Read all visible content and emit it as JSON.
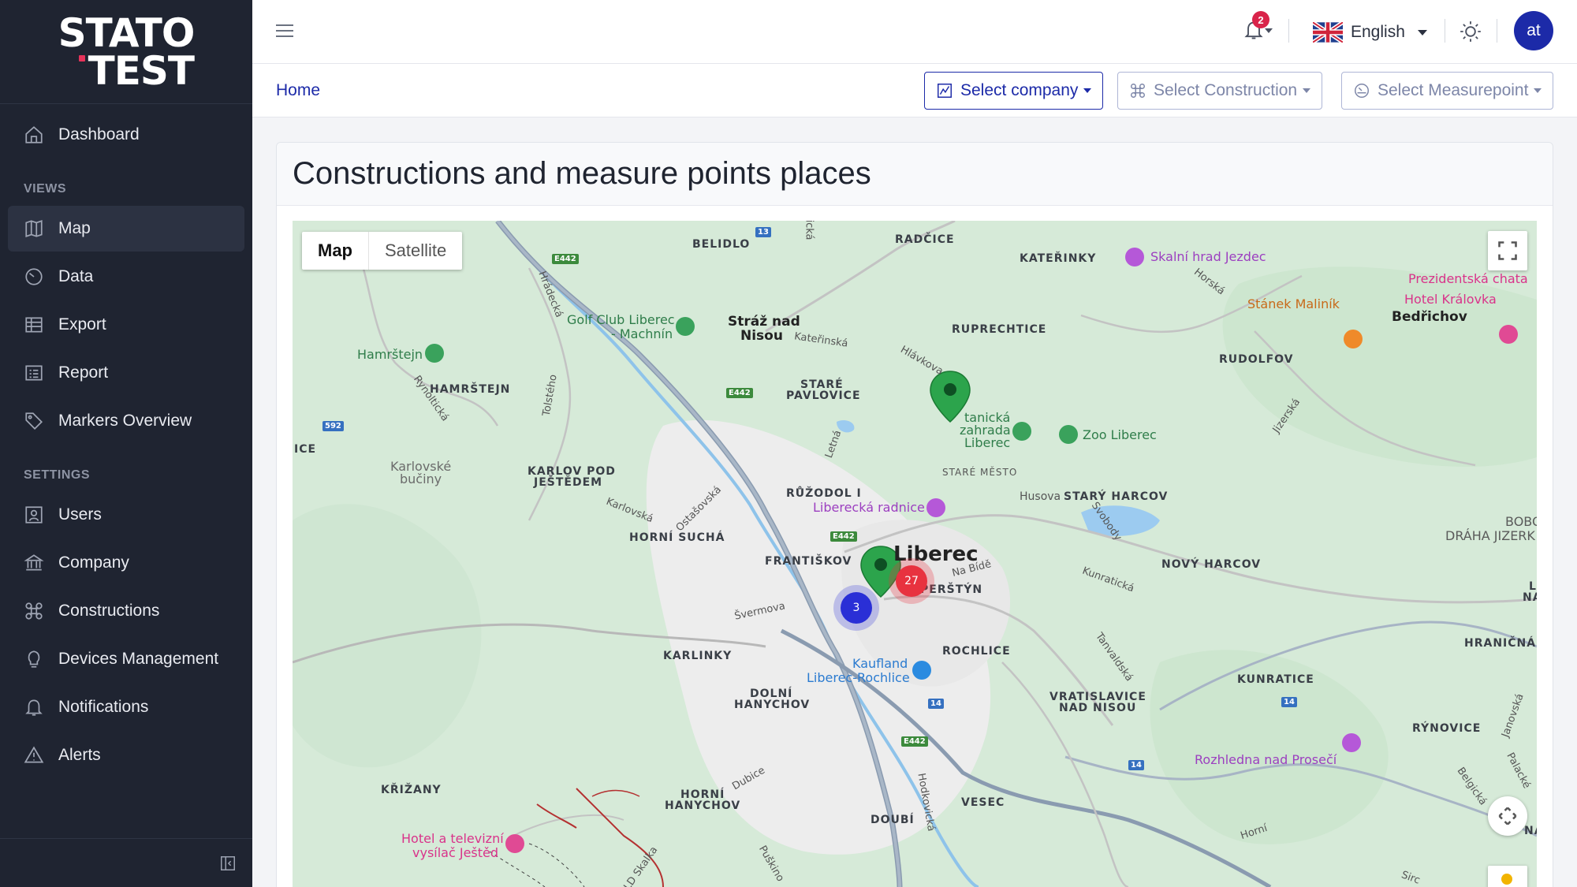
{
  "brand": {
    "line1": "STATO",
    "line2": "TEST"
  },
  "sidebar": {
    "dashboard": "Dashboard",
    "views_heading": "VIEWS",
    "views": [
      "Map",
      "Data",
      "Export",
      "Report",
      "Markers Overview"
    ],
    "settings_heading": "SETTINGS",
    "settings": [
      "Users",
      "Company",
      "Constructions",
      "Devices Management",
      "Notifications",
      "Alerts"
    ],
    "active": "Map"
  },
  "topbar": {
    "notification_count": "2",
    "language": "English",
    "avatar_initials": "at"
  },
  "breadcrumb": {
    "home": "Home"
  },
  "selectors": {
    "company": "Select company",
    "construction": "Select Construction",
    "measurepoint": "Select Measurepoint"
  },
  "card": {
    "title": "Constructions and measure points places"
  },
  "map": {
    "type_map": "Map",
    "type_satellite": "Satellite",
    "clusters": {
      "blue": "3",
      "red": "27"
    },
    "city": "Liberec",
    "labels": {
      "belidlo": "BELIDLO",
      "radcice": "RADČICE",
      "katerinky": "KATEŘINKY",
      "skalni": "Skalní hrad Jezdec",
      "prezidentska": "Prezidentská chata",
      "stanek": "Stánek Maliník",
      "hotel_kralovka": "Hotel Královka",
      "bedrichov": "Bedřichov",
      "golf1": "Golf Club Liberec",
      "golf2": "- Machnín",
      "straz1": "Stráž nad",
      "straz2": "Nisou",
      "ruprechtice": "RUPRECHTICE",
      "rudolfov": "RUDOLFOV",
      "hamrstejn_poi": "Hamrštejn",
      "hamrstejn": "HAMRŠTEJN",
      "stare_pavlovice1": "STARÉ",
      "stare_pavlovice2": "PAVLOVICE",
      "botanicka1": "tanická",
      "botanicka2": "zahrada",
      "botanicka3": "Liberec",
      "zoo": "Zoo Liberec",
      "ice": "ICE",
      "karlovske1": "Karlovské",
      "karlovske2": "bučiny",
      "karlov1": "KARLOV POD",
      "karlov2": "JEŠTĚDEM",
      "stare_mesto": "STARÉ MĚSTO",
      "husova": "Husova",
      "stary_harcov": "STARÝ HARCOV",
      "bobov1": "BOBOV",
      "bobov2": "DRÁHA JIZERK",
      "ruzodol": "RŮŽODOL I",
      "radnice": "Liberecká radnice",
      "horni_sucha": "HORNÍ SUCHÁ",
      "frantiskov": "FRANTIŠKOV",
      "perstyn": "PERŠTÝN",
      "novy_harcov": "NOVÝ HARCOV",
      "kunraticka": "Kunratická",
      "svermova": "Švermova",
      "rochlice": "ROCHLICE",
      "hranicna": "HRANIČNÁ",
      "karlinky": "KARLINKY",
      "kaufland1": "Kaufland",
      "kaufland2": "Liberec-Rochlice",
      "dolni1": "DOLNÍ",
      "dolni2": "HANYCHOV",
      "vratislavice1": "VRATISLAVICE",
      "vratislavice2": "NAD NISOU",
      "kunratice": "KUNRATICE",
      "rynovice": "RÝNOVICE",
      "rozhledna": "Rozhledna nad Prosečí",
      "krizany": "KŘIŽANY",
      "horni_hanychov1": "HORNÍ",
      "horni_hanychov2": "HANYCHOV",
      "vesec": "VESEC",
      "doubi": "DOUBÍ",
      "hotel_tv1": "Hotel a televizní",
      "hotel_tv2": "vysílač Ještěd",
      "horni": "Horní",
      "na_bide": "Na Bídě",
      "katerinska": "Kateřinská",
      "hlavkova": "Hlávkova",
      "letna": "Letná",
      "karlovska": "Karlovská",
      "ostasovska": "Ostašovská",
      "hradecka": "Hrádecká",
      "tolstho": "Tolstého",
      "rynolticka": "Rynoltická",
      "svobody": "Svobody",
      "tanvaldska": "Tanvaldská",
      "jizerska": "Jizerská",
      "horska": "Horská",
      "dubice": "Dubice",
      "hodkovicka": "Hodkovická",
      "janovska": "Janovská",
      "palackeho": "Palacké",
      "belgicka": "Belgická",
      "puskinova": "Puškino",
      "skalka": "LD Skalka",
      "ka": "ická",
      "l_right": "L",
      "na_right": "NA",
      "na_right2": "NA",
      "sircova": "Sirc",
      "road_e442_a": "E442",
      "road_e442_b": "E442",
      "road_e442_c": "E442",
      "road_e442_d": "E442",
      "road_13": "13",
      "road_592": "592",
      "road_14a": "14",
      "road_14b": "14",
      "road_14c": "14"
    }
  },
  "colors": {
    "sidebar_bg": "#1f2431",
    "accent": "#1c2aa8",
    "badge": "#d9244a",
    "cluster_blue": "#2a2fd6",
    "cluster_red": "#e8323f",
    "marker_green": "#2ca44c"
  }
}
